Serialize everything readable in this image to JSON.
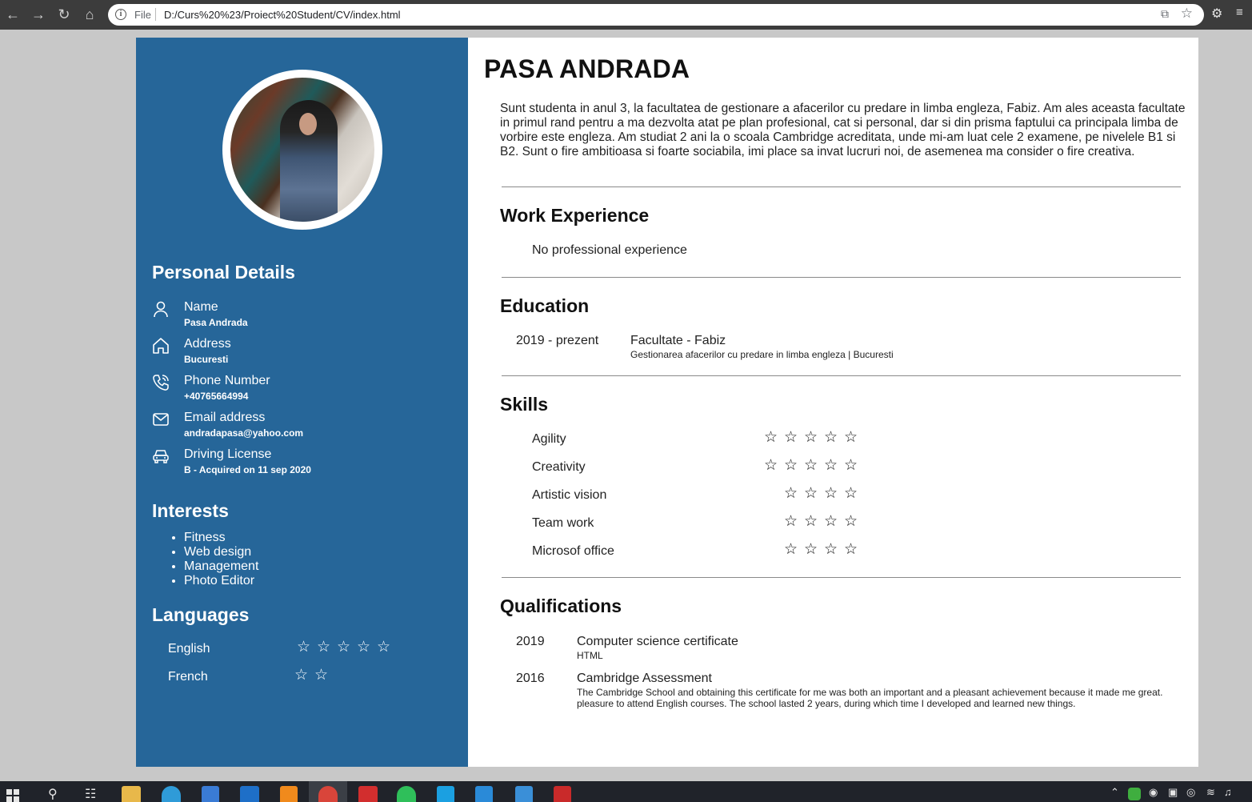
{
  "browser": {
    "file_label": "File",
    "url": "D:/Curs%20%23/Proiect%20Student/CV/index.html"
  },
  "sidebar": {
    "personal_heading": "Personal Details",
    "details": [
      {
        "icon": "person-icon",
        "label": "Name",
        "value": "Pasa Andrada"
      },
      {
        "icon": "home-icon",
        "label": "Address",
        "value": "Bucuresti"
      },
      {
        "icon": "phone-icon",
        "label": "Phone Number",
        "value": "+40765664994"
      },
      {
        "icon": "mail-icon",
        "label": "Email address",
        "value": "andradapasa@yahoo.com"
      },
      {
        "icon": "car-icon",
        "label": "Driving License",
        "value": "B - Acquired on 11 sep 2020"
      }
    ],
    "interests_heading": "Interests",
    "interests": [
      "Fitness",
      "Web design",
      "Management",
      "Photo Editor"
    ],
    "languages_heading": "Languages",
    "languages": [
      {
        "name": "English",
        "stars": 5
      },
      {
        "name": "French",
        "stars": 2
      }
    ]
  },
  "main": {
    "name": "PASA ANDRADA",
    "about": "Sunt studenta in anul 3, la facultatea de gestionare a afacerilor cu predare in limba engleza, Fabiz. Am ales aceasta facultate in primul rand pentru a ma dezvolta atat pe plan profesional, cat si personal, dar si din prisma faptului ca principala limba de vorbire este engleza. Am studiat 2 ani la o scoala Cambridge acreditata, unde mi-am luat cele 2 examene, pe nivelele B1 si B2. Sunt o fire ambitioasa si foarte sociabila, imi place sa invat lucruri noi, de asemenea ma consider o fire creativa.",
    "work_heading": "Work Experience",
    "work_text": "No professional experience",
    "education_heading": "Education",
    "education": {
      "period": "2019 - prezent",
      "title": "Facultate - Fabiz",
      "detail": "Gestionarea afacerilor cu predare in limba engleza | Bucuresti"
    },
    "skills_heading": "Skills",
    "skills": [
      {
        "name": "Agility",
        "stars": 5
      },
      {
        "name": "Creativity",
        "stars": 5
      },
      {
        "name": "Artistic vision",
        "stars": 4
      },
      {
        "name": "Team work",
        "stars": 4
      },
      {
        "name": "Microsof office",
        "stars": 4
      }
    ],
    "qualifications_heading": "Qualifications",
    "qualifications": [
      {
        "year": "2019",
        "title": "Computer science certificate",
        "detail": "HTML"
      },
      {
        "year": "2016",
        "title": "Cambridge Assessment",
        "detail": "The Cambridge School and obtaining this certificate for me was both an important and a pleasant achievement because it made me great. pleasure to attend English courses. The school lasted 2 years, during which time I developed and learned new things."
      }
    ]
  },
  "colors": {
    "sidebar": "#266699",
    "chrome": "#3c3c3c",
    "taskbar": "#20232a"
  }
}
